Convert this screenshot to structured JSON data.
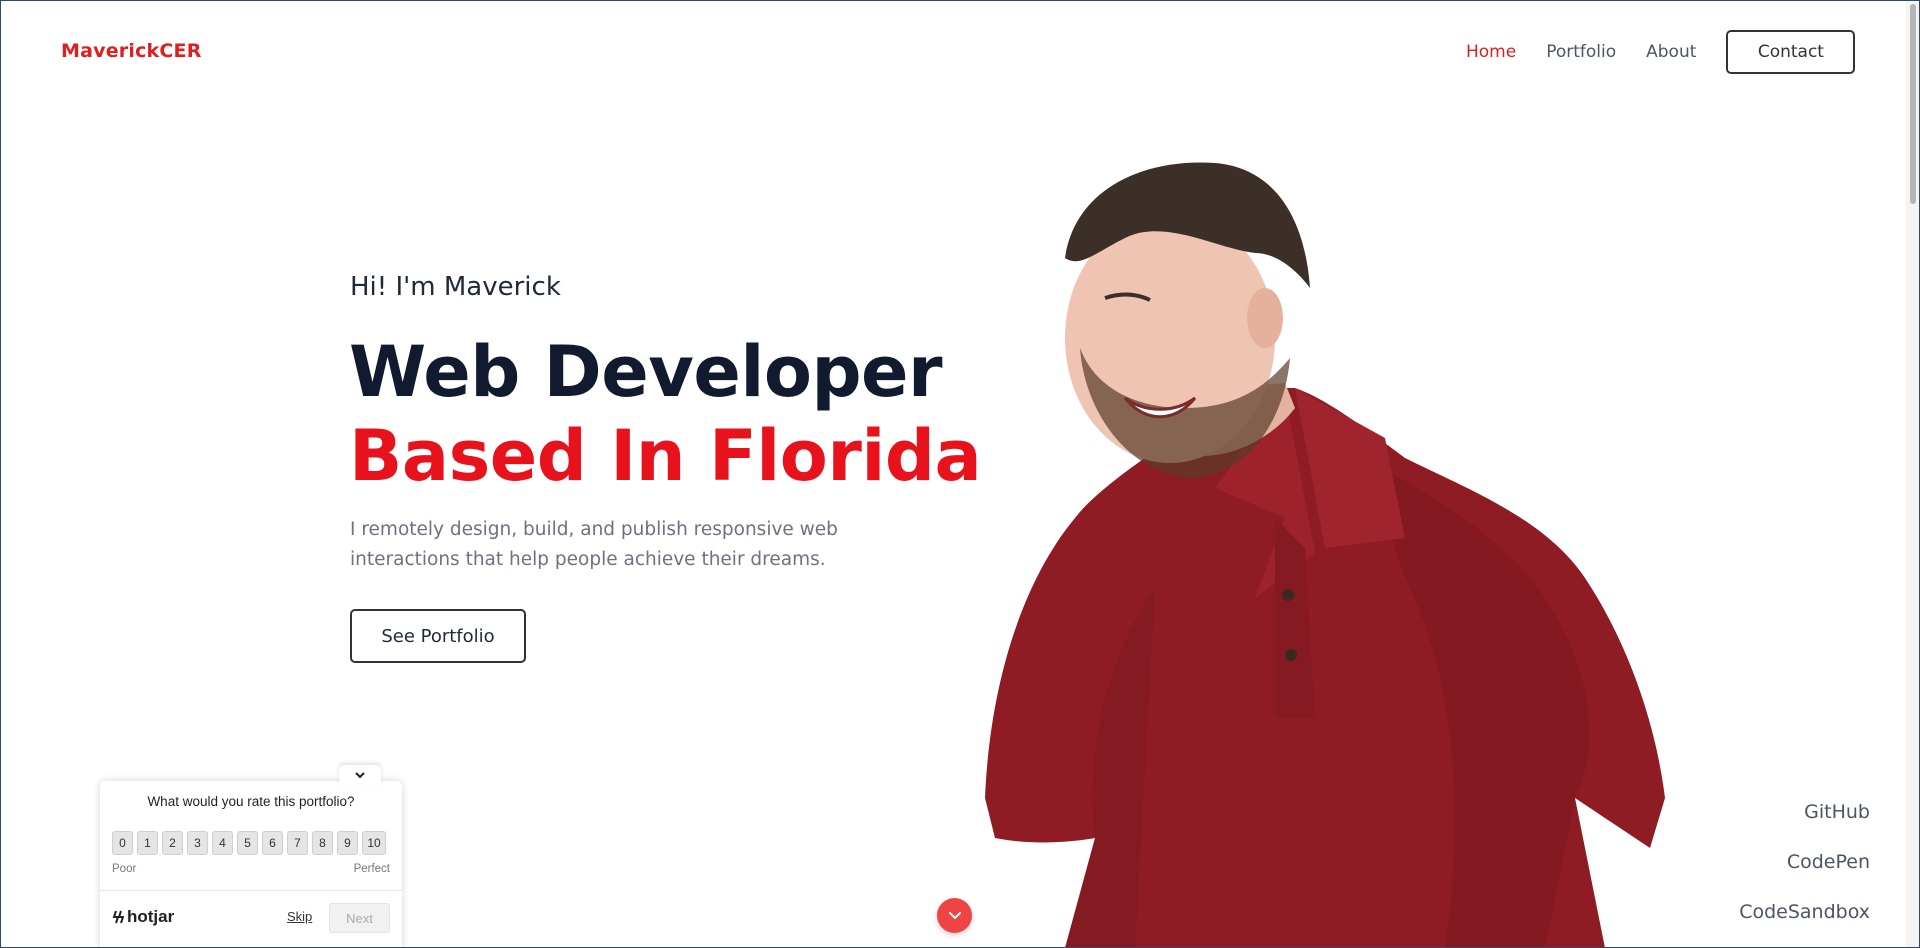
{
  "header": {
    "logo": "MaverickCER",
    "nav": [
      {
        "label": "Home",
        "active": true
      },
      {
        "label": "Portfolio",
        "active": false
      },
      {
        "label": "About",
        "active": false
      }
    ],
    "contact_label": "Contact"
  },
  "hero": {
    "greeting": "Hi! I'm Maverick",
    "headline_1": "Web Developer",
    "headline_2": "Based In Florida",
    "description": "I remotely design, build, and publish responsive web interactions that help people achieve their dreams.",
    "cta_label": "See Portfolio"
  },
  "social": {
    "links": [
      "GitHub",
      "CodePen",
      "CodeSandbox"
    ]
  },
  "hotjar": {
    "question": "What would you rate this portfolio?",
    "scale": [
      "0",
      "1",
      "2",
      "3",
      "4",
      "5",
      "6",
      "7",
      "8",
      "9",
      "10"
    ],
    "low_label": "Poor",
    "high_label": "Perfect",
    "brand": "hotjar",
    "skip_label": "Skip",
    "next_label": "Next"
  },
  "colors": {
    "accent": "#dc1f1f",
    "headline_red": "#e8121c",
    "headline_dark": "#111a2e",
    "shirt": "#8f1c24"
  },
  "icons": [
    "chevron-down-icon",
    "scroll-down-icon",
    "hotjar-logo-icon"
  ]
}
